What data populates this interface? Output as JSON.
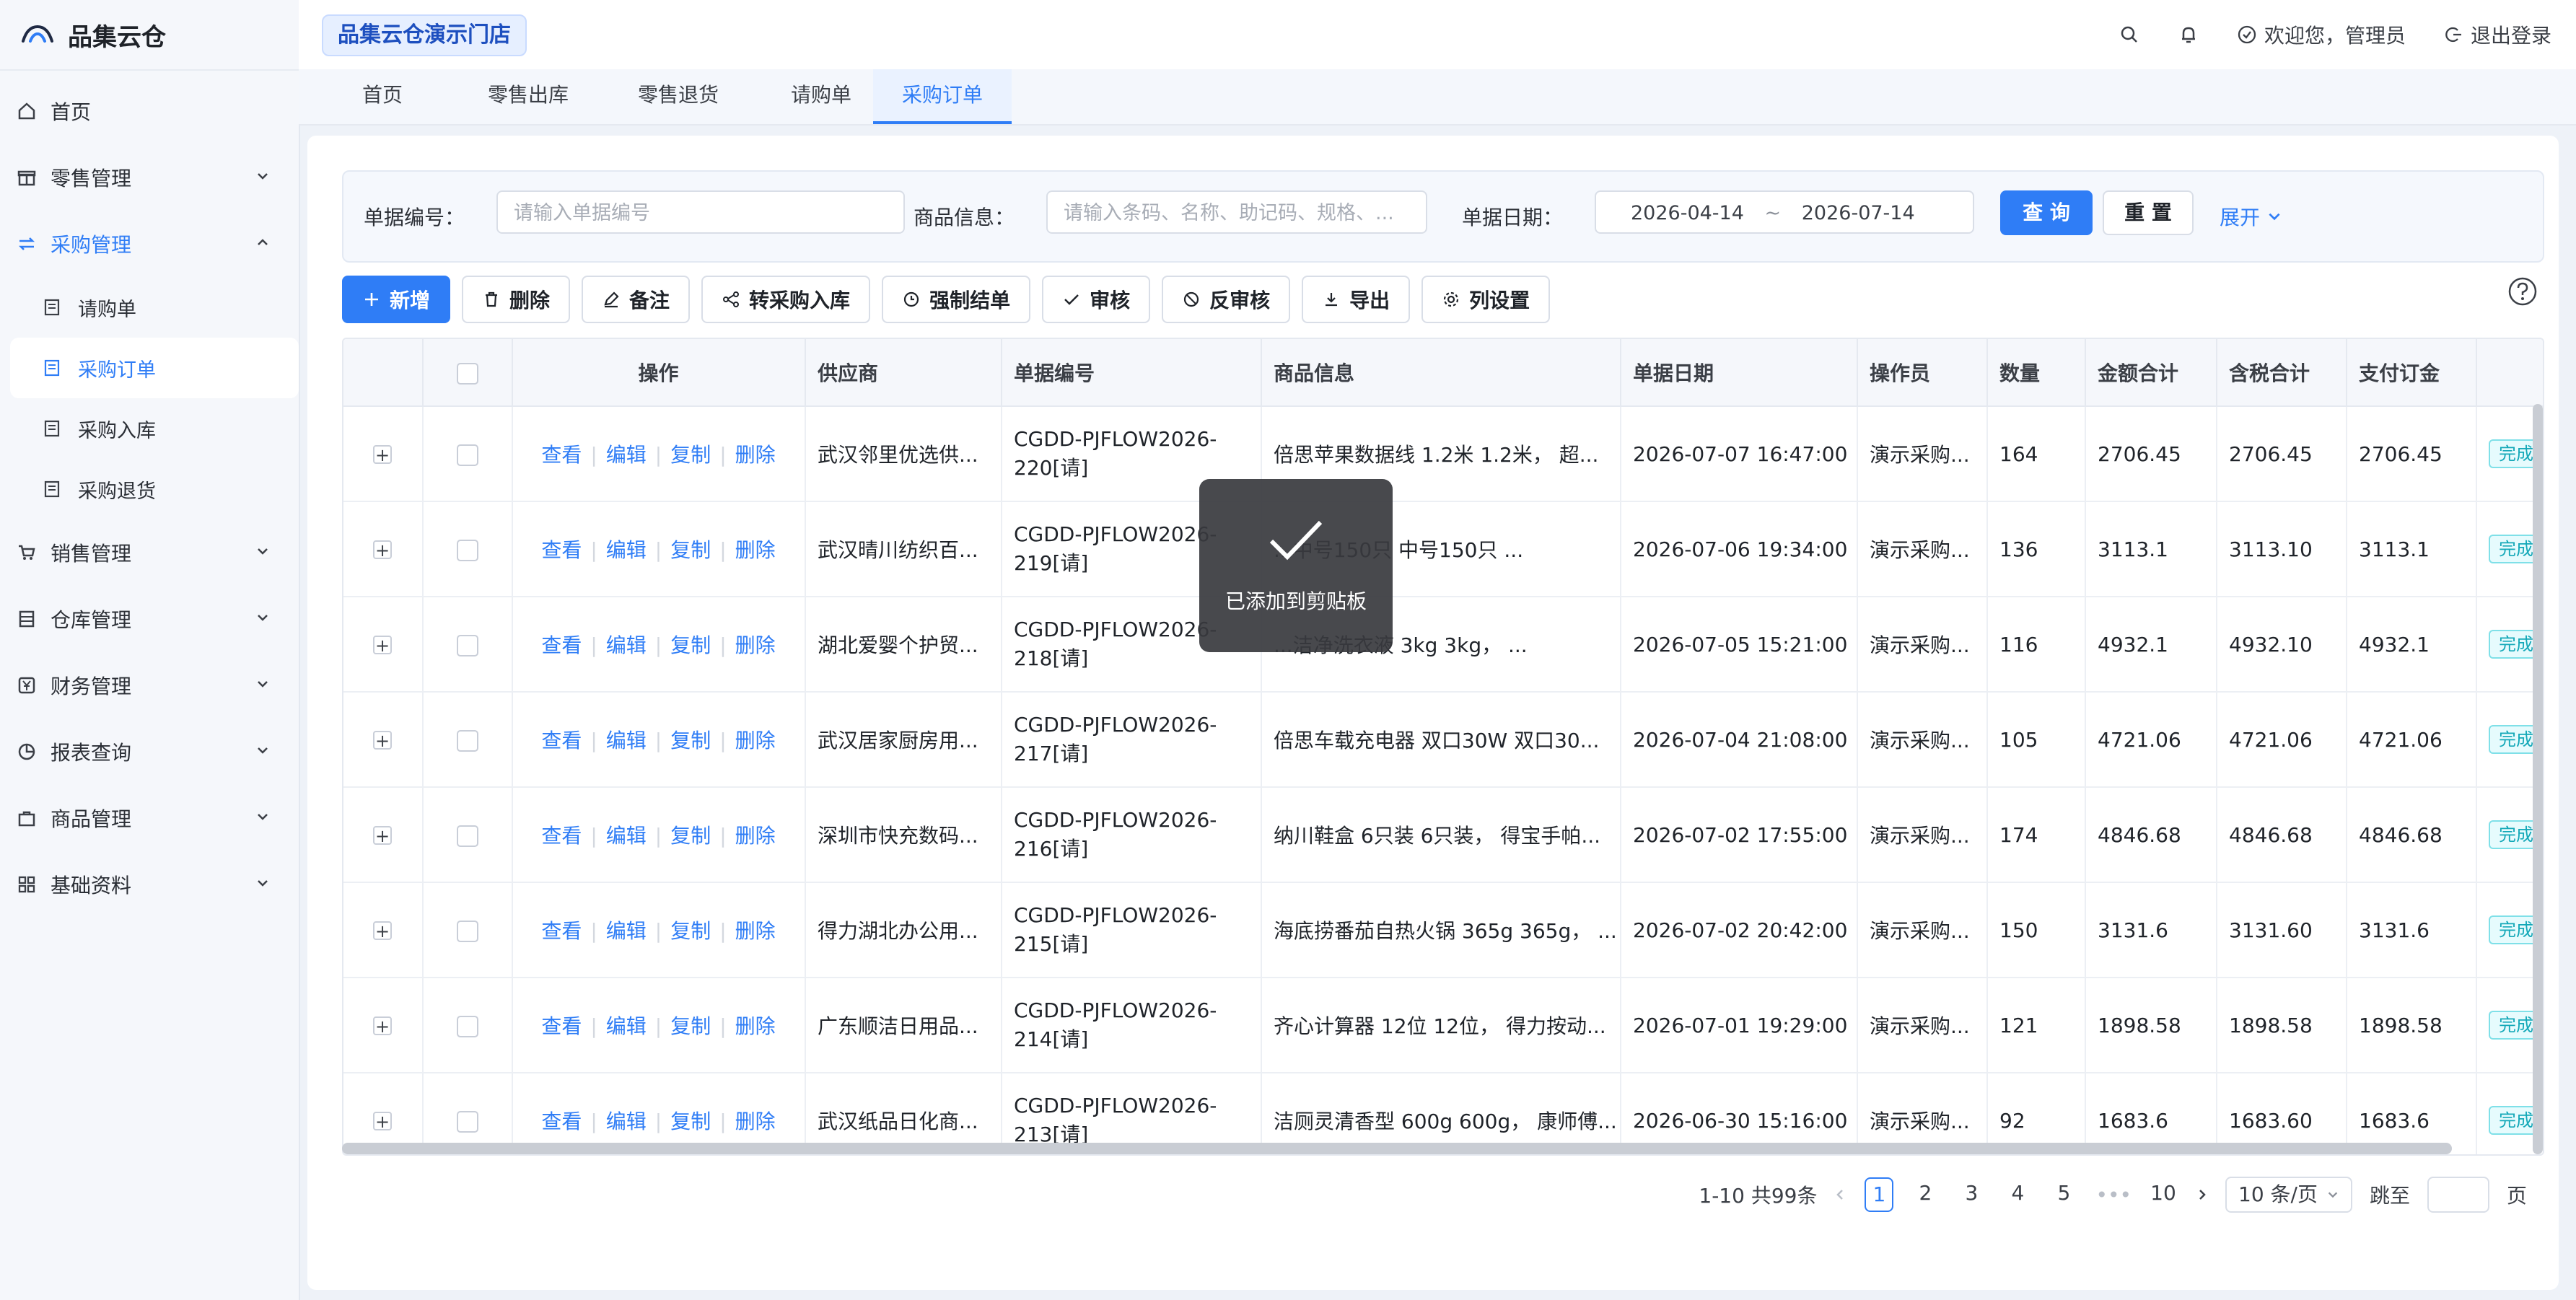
{
  "app": {
    "title": "品集云仓"
  },
  "sidebar": {
    "items": [
      {
        "label": "首页",
        "icon": "home-icon"
      },
      {
        "label": "零售管理",
        "icon": "gift-icon"
      },
      {
        "label": "采购管理",
        "icon": "swap-icon",
        "active": true
      },
      {
        "label": "销售管理",
        "icon": "cart-icon"
      },
      {
        "label": "仓库管理",
        "icon": "warehouse-icon"
      },
      {
        "label": "财务管理",
        "icon": "yen-icon"
      },
      {
        "label": "报表查询",
        "icon": "pie-chart-icon"
      },
      {
        "label": "商品管理",
        "icon": "bag-icon"
      },
      {
        "label": "基础资料",
        "icon": "grid-icon"
      }
    ],
    "purchase_sub": [
      "请购单",
      "采购订单",
      "采购入库",
      "采购退货"
    ],
    "purchase_sub_selected": "采购订单"
  },
  "header": {
    "store": "品集云仓演示门店",
    "welcome": "欢迎您，管理员",
    "logout": "退出登录"
  },
  "tabs": [
    "首页",
    "零售出库",
    "零售退货",
    "请购单",
    "采购订单"
  ],
  "active_tab": "采购订单",
  "filters": {
    "order_no_label": "单据编号：",
    "order_no_placeholder": "请输入单据编号",
    "goods_label": "商品信息：",
    "goods_placeholder": "请输入条码、名称、助记码、规格、...",
    "date_label": "单据日期：",
    "date_start": "2026-04-14",
    "date_sep": "~",
    "date_end": "2026-07-14",
    "query": "查 询",
    "reset": "重 置",
    "expand": "展开"
  },
  "toolbar": {
    "add": "新增",
    "delete": "删除",
    "remark": "备注",
    "to_inbound": "转采购入库",
    "force_close": "强制结单",
    "audit": "审核",
    "unaudit": "反审核",
    "export": "导出",
    "columns": "列设置"
  },
  "table": {
    "headers": [
      "操作",
      "供应商",
      "单据编号",
      "商品信息",
      "单据日期",
      "操作员",
      "数量",
      "金额合计",
      "含税合计",
      "支付订金"
    ],
    "ops": [
      "查看",
      "编辑",
      "复制",
      "删除"
    ],
    "status_label": "完成",
    "rows": [
      {
        "supplier": "武汉邻里优选供...",
        "no": "CGDD-PJFLOW2026-220[请]",
        "goods": "倍思苹果数据线 1.2米 1.2米， 超...",
        "date": "2026-07-07 16:47:00",
        "operator": "演示采购...",
        "qty": "164",
        "amount": "2706.45",
        "tax": "2706.45",
        "deposit": "2706.45"
      },
      {
        "supplier": "武汉晴川纺织百...",
        "no": "CGDD-PJFLOW2026-219[请]",
        "goods": "...中号150只 中号150只 ...",
        "date": "2026-07-06 19:34:00",
        "operator": "演示采购...",
        "qty": "136",
        "amount": "3113.1",
        "tax": "3113.10",
        "deposit": "3113.1"
      },
      {
        "supplier": "湖北爱婴个护贸...",
        "no": "CGDD-PJFLOW2026-218[请]",
        "goods": "...洁净洗衣液 3kg 3kg， ...",
        "date": "2026-07-05 15:21:00",
        "operator": "演示采购...",
        "qty": "116",
        "amount": "4932.1",
        "tax": "4932.10",
        "deposit": "4932.1"
      },
      {
        "supplier": "武汉居家厨房用...",
        "no": "CGDD-PJFLOW2026-217[请]",
        "goods": "倍思车载充电器 双口30W 双口30...",
        "date": "2026-07-04 21:08:00",
        "operator": "演示采购...",
        "qty": "105",
        "amount": "4721.06",
        "tax": "4721.06",
        "deposit": "4721.06"
      },
      {
        "supplier": "深圳市快充数码...",
        "no": "CGDD-PJFLOW2026-216[请]",
        "goods": "纳川鞋盒 6只装 6只装， 得宝手帕...",
        "date": "2026-07-02 17:55:00",
        "operator": "演示采购...",
        "qty": "174",
        "amount": "4846.68",
        "tax": "4846.68",
        "deposit": "4846.68"
      },
      {
        "supplier": "得力湖北办公用...",
        "no": "CGDD-PJFLOW2026-215[请]",
        "goods": "海底捞番茄自热火锅 365g 365g， ...",
        "date": "2026-07-02 20:42:00",
        "operator": "演示采购...",
        "qty": "150",
        "amount": "3131.6",
        "tax": "3131.60",
        "deposit": "3131.6"
      },
      {
        "supplier": "广东顺洁日用品...",
        "no": "CGDD-PJFLOW2026-214[请]",
        "goods": "齐心计算器 12位 12位， 得力按动...",
        "date": "2026-07-01 19:29:00",
        "operator": "演示采购...",
        "qty": "121",
        "amount": "1898.58",
        "tax": "1898.58",
        "deposit": "1898.58"
      },
      {
        "supplier": "武汉纸品日化商...",
        "no": "CGDD-PJFLOW2026-213[请]",
        "goods": "洁厕灵清香型 600g 600g， 康师傅...",
        "date": "2026-06-30 15:16:00",
        "operator": "演示采购...",
        "qty": "92",
        "amount": "1683.6",
        "tax": "1683.60",
        "deposit": "1683.6"
      }
    ]
  },
  "pagination": {
    "summary": "1-10 共99条",
    "pages": [
      "1",
      "2",
      "3",
      "4",
      "5"
    ],
    "ellipsis": "•••",
    "last": "10",
    "current": "1",
    "page_size": "10 条/页",
    "jump_label": "跳至",
    "page_suffix": "页"
  },
  "toast": {
    "text": "已添加到剪贴板"
  },
  "colors": {
    "primary": "#2f7df6",
    "status": "#13a8b8"
  }
}
